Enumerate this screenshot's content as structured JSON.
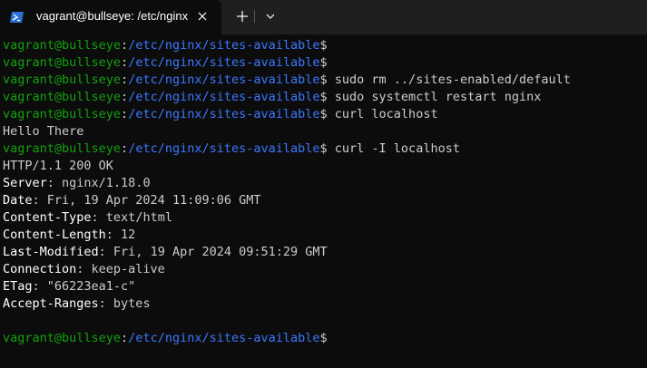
{
  "tab": {
    "title": "vagrant@bullseye: /etc/nginx",
    "icon": "powershell-icon"
  },
  "colors": {
    "prompt_user": "#13a10e",
    "prompt_path": "#3b78ff",
    "text": "#cccccc",
    "background": "#0c0c0c"
  },
  "prompt": {
    "user": "vagrant@bullseye",
    "sep": ":",
    "path": "/etc/nginx/sites-available",
    "symbol": "$"
  },
  "lines": [
    {
      "type": "prompt",
      "cmd": ""
    },
    {
      "type": "prompt",
      "cmd": ""
    },
    {
      "type": "prompt",
      "cmd": " sudo rm ../sites-enabled/default"
    },
    {
      "type": "prompt",
      "cmd": " sudo systemctl restart nginx"
    },
    {
      "type": "prompt",
      "cmd": " curl localhost"
    },
    {
      "type": "text",
      "text": "Hello There"
    },
    {
      "type": "prompt",
      "cmd": " curl -I localhost"
    },
    {
      "type": "text",
      "text": "HTTP/1.1 200 OK"
    },
    {
      "type": "header",
      "name": "Server",
      "value": ": nginx/1.18.0"
    },
    {
      "type": "header",
      "name": "Date",
      "value": ": Fri, 19 Apr 2024 11:09:06 GMT"
    },
    {
      "type": "header",
      "name": "Content-Type",
      "value": ": text/html"
    },
    {
      "type": "header",
      "name": "Content-Length",
      "value": ": 12"
    },
    {
      "type": "header",
      "name": "Last-Modified",
      "value": ": Fri, 19 Apr 2024 09:51:29 GMT"
    },
    {
      "type": "header",
      "name": "Connection",
      "value": ": keep-alive"
    },
    {
      "type": "header",
      "name": "ETag",
      "value": ": \"66223ea1-c\""
    },
    {
      "type": "header",
      "name": "Accept-Ranges",
      "value": ": bytes"
    },
    {
      "type": "text",
      "text": ""
    },
    {
      "type": "prompt",
      "cmd": ""
    }
  ]
}
